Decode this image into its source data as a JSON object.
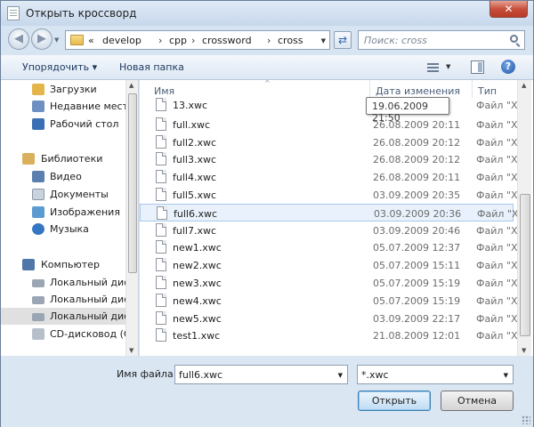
{
  "window": {
    "title": "Открыть кроссворд",
    "close_glyph": "✕"
  },
  "address_bar": {
    "overflow": "«",
    "crumbs": [
      "develop",
      "cpp",
      "crossword",
      "cross"
    ],
    "separator": "›"
  },
  "search": {
    "placeholder": "Поиск: cross"
  },
  "toolbar": {
    "organize_label": "Упорядочить ▾",
    "new_folder_label": "Новая папка",
    "help_glyph": "?"
  },
  "nav_pane": {
    "items": [
      {
        "label": "Загрузки",
        "icon": "downloads-folder-icon",
        "color": "#e4b54a"
      },
      {
        "label": "Недавние места",
        "icon": "recent-places-icon",
        "color": "#6d8fc2"
      },
      {
        "label": "Рабочий стол",
        "icon": "desktop-icon",
        "color": "#3a6fb5"
      },
      {
        "label": "Библиотеки",
        "icon": "libraries-icon",
        "color": "#d9b15c"
      },
      {
        "label": "Видео",
        "icon": "video-library-icon",
        "color": "#5b7fae"
      },
      {
        "label": "Документы",
        "icon": "documents-library-icon",
        "color": "#c9d3de"
      },
      {
        "label": "Изображения",
        "icon": "pictures-library-icon",
        "color": "#5b9bd0"
      },
      {
        "label": "Музыка",
        "icon": "music-library-icon",
        "color": "#3576c2"
      },
      {
        "label": "Компьютер",
        "icon": "computer-icon",
        "color": "#4f76a8"
      },
      {
        "label": "Локальный диск",
        "icon": "local-disk-icon",
        "color": "#9aa6b3"
      },
      {
        "label": "Локальный диск",
        "icon": "local-disk-icon",
        "color": "#9aa6b3"
      },
      {
        "label": "Локальный диск",
        "icon": "local-disk-icon",
        "color": "#9aa6b3"
      },
      {
        "label": "CD-дисковод (G:",
        "icon": "cd-drive-icon",
        "color": "#b7c0ca"
      }
    ]
  },
  "file_list": {
    "columns": [
      "Имя",
      "Дата изменения",
      "Тип"
    ],
    "tooltip": "19.06.2009 21:50",
    "rows": [
      {
        "name": "13.xwc",
        "date": "",
        "type": "Файл \"XV"
      },
      {
        "name": "full.xwc",
        "date": "26.08.2009 20:11",
        "type": "Файл \"XV"
      },
      {
        "name": "full2.xwc",
        "date": "26.08.2009 20:12",
        "type": "Файл \"XV"
      },
      {
        "name": "full3.xwc",
        "date": "26.08.2009 20:12",
        "type": "Файл \"XV"
      },
      {
        "name": "full4.xwc",
        "date": "26.08.2009 20:11",
        "type": "Файл \"XV"
      },
      {
        "name": "full5.xwc",
        "date": "03.09.2009 20:35",
        "type": "Файл \"XV"
      },
      {
        "name": "full6.xwc",
        "date": "03.09.2009 20:36",
        "type": "Файл \"XV"
      },
      {
        "name": "full7.xwc",
        "date": "03.09.2009 20:46",
        "type": "Файл \"XV"
      },
      {
        "name": "new1.xwc",
        "date": "05.07.2009 12:37",
        "type": "Файл \"XV"
      },
      {
        "name": "new2.xwc",
        "date": "05.07.2009 15:11",
        "type": "Файл \"XV"
      },
      {
        "name": "new3.xwc",
        "date": "05.07.2009 15:19",
        "type": "Файл \"XV"
      },
      {
        "name": "new4.xwc",
        "date": "05.07.2009 15:19",
        "type": "Файл \"XV"
      },
      {
        "name": "new5.xwc",
        "date": "03.09.2009 22:17",
        "type": "Файл \"XV"
      },
      {
        "name": "test1.xwc",
        "date": "21.08.2009 12:01",
        "type": "Файл \"XV"
      }
    ],
    "selected_name": "full6.xwc"
  },
  "bottom": {
    "filename_label": "Имя файла:",
    "filename_value": "full6.xwc",
    "filter_value": "*.xwc",
    "open_label": "Открыть",
    "cancel_label": "Отмена"
  }
}
